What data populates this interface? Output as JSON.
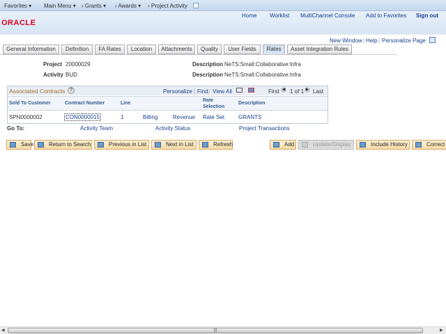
{
  "nav": {
    "favorites": "Favorites",
    "main_menu": "Main Menu",
    "crumbs": [
      "Grants",
      "Awards",
      "Project Activity"
    ]
  },
  "header": {
    "links": [
      "Home",
      "Worklist",
      "MultiChannel Console",
      "Add to Favorites",
      "Sign out"
    ],
    "logo": "ORACLE"
  },
  "toolbar": {
    "new_window": "New Window",
    "help": "Help",
    "personalize": "Personalize Page"
  },
  "tabs": [
    "General Information",
    "Definition",
    "FA Rates",
    "Location",
    "Attachments",
    "Quality",
    "User Fields",
    "Rates",
    "Asset Integration Rules"
  ],
  "active_tab": "Rates",
  "fields": {
    "project_label": "Project",
    "project": "20000029",
    "activity_label": "Activity",
    "activity": "BUD",
    "desc_label": "Description",
    "project_desc": "NeTS:Small:Collaborative:Infra",
    "activity_desc": "NeTS:Small:Collaborative:Infra"
  },
  "grid": {
    "title": "Associated Contracts",
    "personalize": "Personalize",
    "find": "Find",
    "view_all": "View All",
    "first": "First",
    "pager": "1 of 1",
    "last": "Last",
    "columns": [
      "Sold To Customer",
      "Contract Number",
      "Line",
      "",
      "",
      "Rate Selection",
      "Description"
    ],
    "row": [
      "SPN0000002",
      "CON0000015",
      "1",
      "Billing",
      "Revenue",
      "Rate Set",
      "GRANTS"
    ]
  },
  "goto": {
    "label": "Go To:",
    "links": [
      "Activity Team",
      "Activity Status",
      "Project Transactions"
    ]
  },
  "buttons": [
    "Save",
    "Return to Search",
    "Previous in List",
    "Next in List",
    "Refresh",
    "Add",
    "Update/Display",
    "Include History",
    "Correct History"
  ]
}
